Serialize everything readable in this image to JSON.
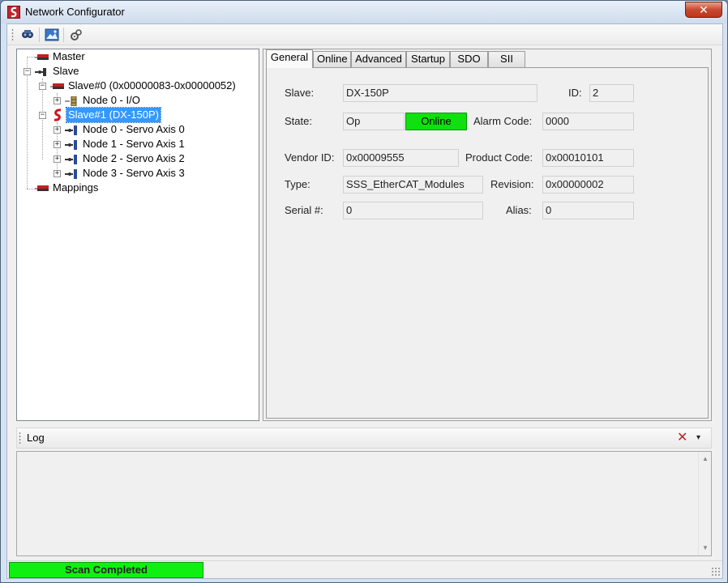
{
  "window": {
    "title": "Network Configurator",
    "close_label": "✕"
  },
  "toolbar": {
    "buttons": [
      "scan-icon",
      "image-icon",
      "configure-icon"
    ]
  },
  "tree": {
    "master": "Master",
    "slave": "Slave",
    "slave0": "Slave#0 (0x00000083-0x00000052)",
    "slave0_node0": "Node 0 - I/O",
    "slave1": "Slave#1 (DX-150P)",
    "slave1_nodes": [
      "Node 0 - Servo Axis 0",
      "Node 1 - Servo Axis 1",
      "Node 2 - Servo Axis 2",
      "Node 3 - Servo Axis 3"
    ],
    "mappings": "Mappings"
  },
  "tabs": [
    "General",
    "Online",
    "Advanced",
    "Startup",
    "SDO",
    "SII"
  ],
  "active_tab": "General",
  "general": {
    "slave_label": "Slave:",
    "slave_value": "DX-150P",
    "id_label": "ID:",
    "id_value": "2",
    "state_label": "State:",
    "state_value": "Op",
    "state_status": "Online",
    "alarm_label": "Alarm Code:",
    "alarm_value": "0000",
    "vendor_label": "Vendor ID:",
    "vendor_value": "0x00009555",
    "product_label": "Product Code:",
    "product_value": "0x00010101",
    "type_label": "Type:",
    "type_value": "SSS_EtherCAT_Modules",
    "revision_label": "Revision:",
    "revision_value": "0x00000002",
    "serial_label": "Serial #:",
    "serial_value": "0",
    "alias_label": "Alias:",
    "alias_value": "0"
  },
  "log": {
    "title": "Log",
    "close_glyph": "✕",
    "menu_glyph": "▾"
  },
  "status": {
    "text": "Scan Completed",
    "progress_fraction": 1.0
  },
  "colors": {
    "online": "#10e010",
    "selection": "#3399ff",
    "progress": "#10f010"
  }
}
